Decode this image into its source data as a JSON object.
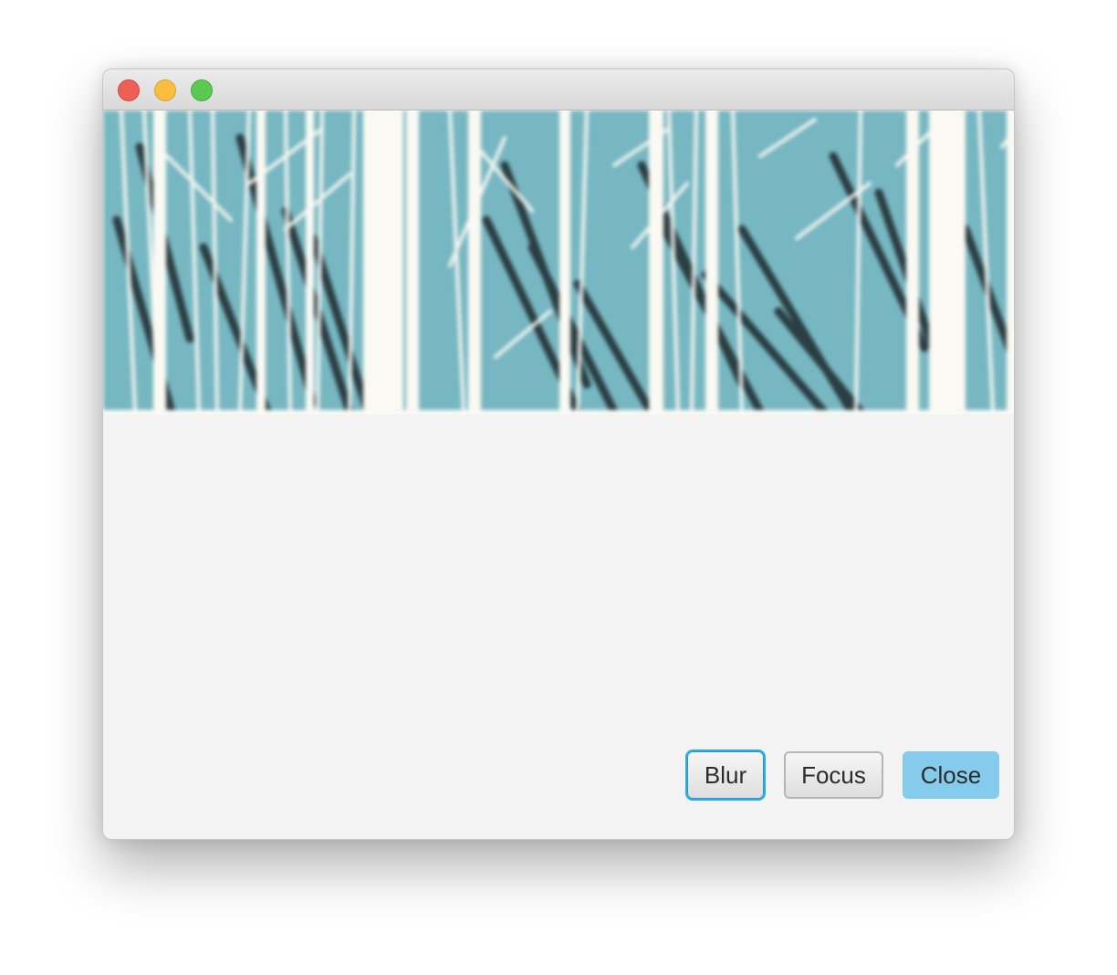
{
  "window": {
    "controls": {
      "close_icon": "close-traffic-light-icon",
      "minimize_icon": "minimize-traffic-light-icon",
      "zoom_icon": "zoom-traffic-light-icon"
    }
  },
  "image": {
    "subject": "blurred-forest-trees",
    "colors": {
      "sky": "#76b7c2",
      "trunks": "#fbf9f3",
      "shadows": "#1f2a2c"
    }
  },
  "buttons": {
    "blur_label": "Blur",
    "focus_label": "Focus",
    "close_label": "Close"
  },
  "colors": {
    "window_bg": "#f3f3f3",
    "focus_ring": "#1a9bd7",
    "default_button": "#84cbec"
  }
}
